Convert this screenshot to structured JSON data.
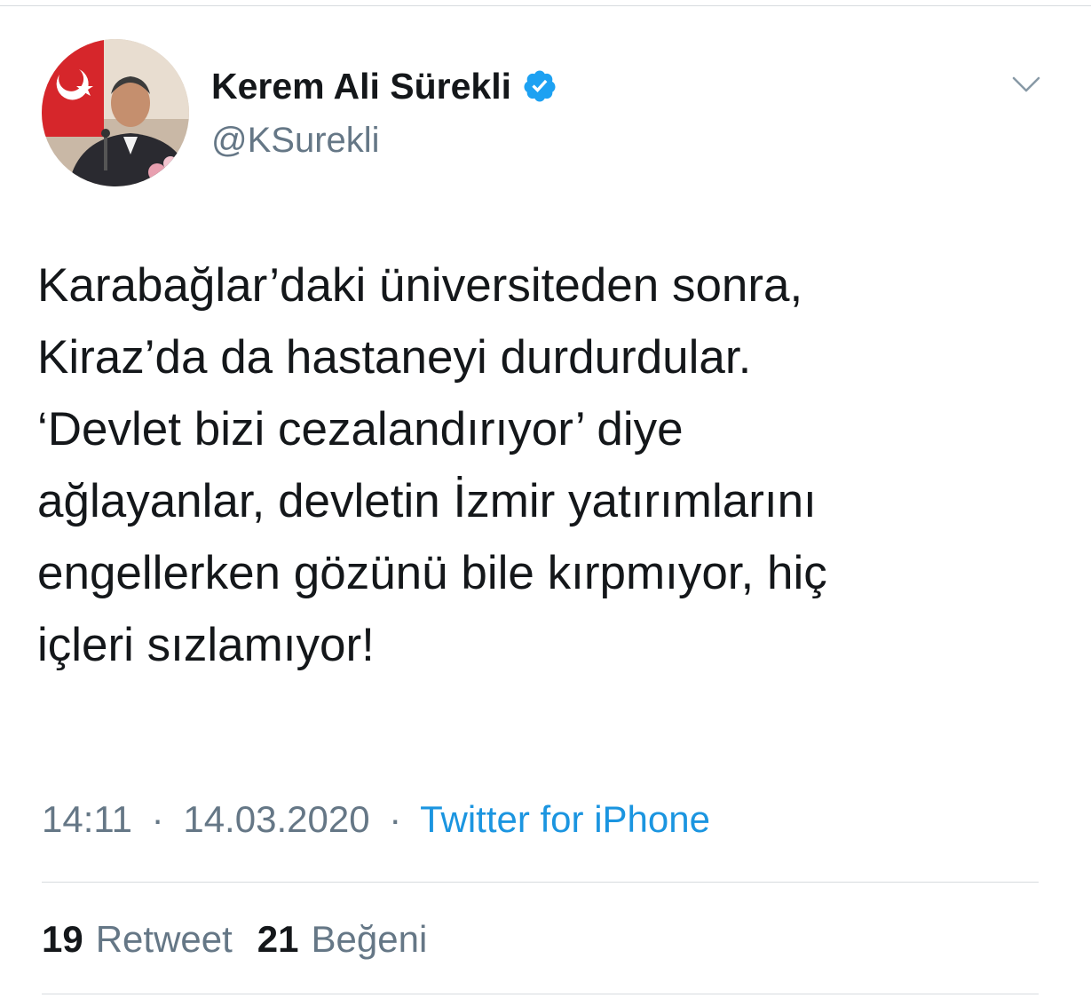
{
  "colors": {
    "primary_text": "#14171a",
    "secondary_text": "#657786",
    "link": "#1b95e0",
    "verified": "#1da1f2",
    "divider": "#d7dbdf"
  },
  "tweet": {
    "author": {
      "display_name": "Kerem Ali Sürekli",
      "handle": "@KSurekli",
      "verified": true,
      "avatar_icon": "profile-photo"
    },
    "menu_icon": "chevron-down-icon",
    "text": "Karabağlar’daki üniversiteden sonra,\nKiraz’da da hastaneyi durdurdular.\n‘Devlet bizi cezalandırıyor’ diye\nağlayanlar, devletin İzmir yatırımlarını\nengellerken gözünü bile kırpmıyor, hiç\niçleri sızlamıyor!",
    "time": "14:11",
    "date": "14.03.2020",
    "separator": "·",
    "source": "Twitter for iPhone",
    "stats": {
      "retweets": {
        "count": "19",
        "label": "Retweet"
      },
      "likes": {
        "count": "21",
        "label": "Beğeni"
      }
    }
  }
}
